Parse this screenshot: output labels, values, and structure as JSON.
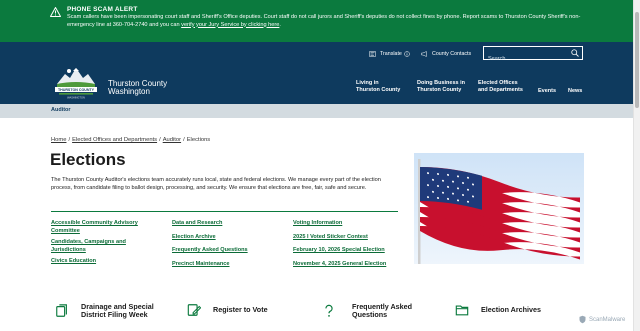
{
  "alert": {
    "title": "PHONE SCAM ALERT",
    "body": "Scam callers have been impersonating court staff and Sheriff's Office deputies. Court staff do not call jurors and Sheriff's deputies do not collect fines by phone. Report scams to Thurston County Sheriff's non-emergency line at 360-704-2740 and you can ",
    "link": "verify your Jury Service by clicking here",
    "link_suffix": "."
  },
  "header": {
    "translate": "Translate",
    "contacts": "County Contacts",
    "search_placeholder": "Search",
    "site_name_1": "Thurston County",
    "site_name_2": "Washington",
    "logo_text": "THURSTON COUNTY",
    "logo_sub": "WASHINGTON",
    "nav": [
      {
        "line1": "Living in",
        "line2": "Thurston County"
      },
      {
        "line1": "Doing Business in",
        "line2": "Thurston County"
      },
      {
        "line1": "Elected Offices",
        "line2": "and Departments"
      },
      {
        "line1": "Events",
        "line2": ""
      },
      {
        "line1": "News",
        "line2": ""
      }
    ]
  },
  "section": {
    "label": "Auditor"
  },
  "breadcrumb": {
    "home": "Home",
    "offices": "Elected Offices and Departments",
    "auditor": "Auditor",
    "current": "Elections",
    "sep": "/"
  },
  "page": {
    "title": "Elections",
    "intro": "The Thurston County Auditor's elections team accurately runs local, state and federal elections. We manage every part of the election process, from candidate filing to ballot design, processing, and security. We ensure that elections are free, fair, safe and secure."
  },
  "links": {
    "col1": [
      "Accessible Community Advisory Committee",
      "Candidates, Campaigns and Jurisdictions",
      "Civics Education"
    ],
    "col2": [
      "Data and Research",
      "Election Archive",
      "Frequently Asked Questions",
      "Precinct Maintenance"
    ],
    "col3": [
      "Voting Information",
      "2025 I Voted Sticker Contest",
      "February 10, 2026 Special Election",
      "November 4, 2025 General Election"
    ]
  },
  "quick": [
    {
      "label": "Drainage and Special District Filing Week",
      "icon": "documents-icon"
    },
    {
      "label": "Register to Vote",
      "icon": "edit-form-icon"
    },
    {
      "label": "Frequently Asked Questions",
      "icon": "question-icon"
    },
    {
      "label": "Election Archives",
      "icon": "folder-icon"
    }
  ],
  "watermark": "ScanMalware",
  "colors": {
    "alert_green": "#0b7a3e",
    "header_navy": "#0e3a5e",
    "section_gray": "#d3dbe0",
    "link_green": "#0b6b37"
  }
}
